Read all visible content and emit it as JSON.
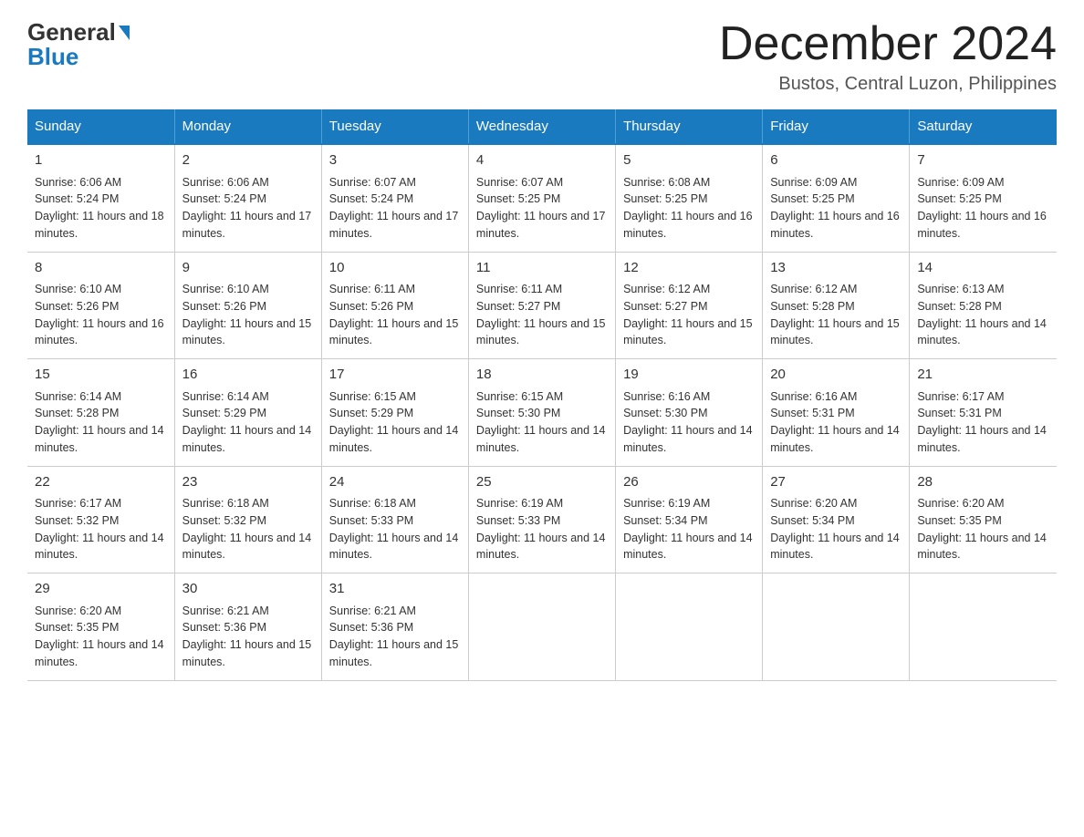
{
  "header": {
    "logo_general": "General",
    "logo_blue": "Blue",
    "month_title": "December 2024",
    "location": "Bustos, Central Luzon, Philippines"
  },
  "days_of_week": [
    "Sunday",
    "Monday",
    "Tuesday",
    "Wednesday",
    "Thursday",
    "Friday",
    "Saturday"
  ],
  "weeks": [
    [
      {
        "day": 1,
        "sunrise": "Sunrise: 6:06 AM",
        "sunset": "Sunset: 5:24 PM",
        "daylight": "Daylight: 11 hours and 18 minutes."
      },
      {
        "day": 2,
        "sunrise": "Sunrise: 6:06 AM",
        "sunset": "Sunset: 5:24 PM",
        "daylight": "Daylight: 11 hours and 17 minutes."
      },
      {
        "day": 3,
        "sunrise": "Sunrise: 6:07 AM",
        "sunset": "Sunset: 5:24 PM",
        "daylight": "Daylight: 11 hours and 17 minutes."
      },
      {
        "day": 4,
        "sunrise": "Sunrise: 6:07 AM",
        "sunset": "Sunset: 5:25 PM",
        "daylight": "Daylight: 11 hours and 17 minutes."
      },
      {
        "day": 5,
        "sunrise": "Sunrise: 6:08 AM",
        "sunset": "Sunset: 5:25 PM",
        "daylight": "Daylight: 11 hours and 16 minutes."
      },
      {
        "day": 6,
        "sunrise": "Sunrise: 6:09 AM",
        "sunset": "Sunset: 5:25 PM",
        "daylight": "Daylight: 11 hours and 16 minutes."
      },
      {
        "day": 7,
        "sunrise": "Sunrise: 6:09 AM",
        "sunset": "Sunset: 5:25 PM",
        "daylight": "Daylight: 11 hours and 16 minutes."
      }
    ],
    [
      {
        "day": 8,
        "sunrise": "Sunrise: 6:10 AM",
        "sunset": "Sunset: 5:26 PM",
        "daylight": "Daylight: 11 hours and 16 minutes."
      },
      {
        "day": 9,
        "sunrise": "Sunrise: 6:10 AM",
        "sunset": "Sunset: 5:26 PM",
        "daylight": "Daylight: 11 hours and 15 minutes."
      },
      {
        "day": 10,
        "sunrise": "Sunrise: 6:11 AM",
        "sunset": "Sunset: 5:26 PM",
        "daylight": "Daylight: 11 hours and 15 minutes."
      },
      {
        "day": 11,
        "sunrise": "Sunrise: 6:11 AM",
        "sunset": "Sunset: 5:27 PM",
        "daylight": "Daylight: 11 hours and 15 minutes."
      },
      {
        "day": 12,
        "sunrise": "Sunrise: 6:12 AM",
        "sunset": "Sunset: 5:27 PM",
        "daylight": "Daylight: 11 hours and 15 minutes."
      },
      {
        "day": 13,
        "sunrise": "Sunrise: 6:12 AM",
        "sunset": "Sunset: 5:28 PM",
        "daylight": "Daylight: 11 hours and 15 minutes."
      },
      {
        "day": 14,
        "sunrise": "Sunrise: 6:13 AM",
        "sunset": "Sunset: 5:28 PM",
        "daylight": "Daylight: 11 hours and 14 minutes."
      }
    ],
    [
      {
        "day": 15,
        "sunrise": "Sunrise: 6:14 AM",
        "sunset": "Sunset: 5:28 PM",
        "daylight": "Daylight: 11 hours and 14 minutes."
      },
      {
        "day": 16,
        "sunrise": "Sunrise: 6:14 AM",
        "sunset": "Sunset: 5:29 PM",
        "daylight": "Daylight: 11 hours and 14 minutes."
      },
      {
        "day": 17,
        "sunrise": "Sunrise: 6:15 AM",
        "sunset": "Sunset: 5:29 PM",
        "daylight": "Daylight: 11 hours and 14 minutes."
      },
      {
        "day": 18,
        "sunrise": "Sunrise: 6:15 AM",
        "sunset": "Sunset: 5:30 PM",
        "daylight": "Daylight: 11 hours and 14 minutes."
      },
      {
        "day": 19,
        "sunrise": "Sunrise: 6:16 AM",
        "sunset": "Sunset: 5:30 PM",
        "daylight": "Daylight: 11 hours and 14 minutes."
      },
      {
        "day": 20,
        "sunrise": "Sunrise: 6:16 AM",
        "sunset": "Sunset: 5:31 PM",
        "daylight": "Daylight: 11 hours and 14 minutes."
      },
      {
        "day": 21,
        "sunrise": "Sunrise: 6:17 AM",
        "sunset": "Sunset: 5:31 PM",
        "daylight": "Daylight: 11 hours and 14 minutes."
      }
    ],
    [
      {
        "day": 22,
        "sunrise": "Sunrise: 6:17 AM",
        "sunset": "Sunset: 5:32 PM",
        "daylight": "Daylight: 11 hours and 14 minutes."
      },
      {
        "day": 23,
        "sunrise": "Sunrise: 6:18 AM",
        "sunset": "Sunset: 5:32 PM",
        "daylight": "Daylight: 11 hours and 14 minutes."
      },
      {
        "day": 24,
        "sunrise": "Sunrise: 6:18 AM",
        "sunset": "Sunset: 5:33 PM",
        "daylight": "Daylight: 11 hours and 14 minutes."
      },
      {
        "day": 25,
        "sunrise": "Sunrise: 6:19 AM",
        "sunset": "Sunset: 5:33 PM",
        "daylight": "Daylight: 11 hours and 14 minutes."
      },
      {
        "day": 26,
        "sunrise": "Sunrise: 6:19 AM",
        "sunset": "Sunset: 5:34 PM",
        "daylight": "Daylight: 11 hours and 14 minutes."
      },
      {
        "day": 27,
        "sunrise": "Sunrise: 6:20 AM",
        "sunset": "Sunset: 5:34 PM",
        "daylight": "Daylight: 11 hours and 14 minutes."
      },
      {
        "day": 28,
        "sunrise": "Sunrise: 6:20 AM",
        "sunset": "Sunset: 5:35 PM",
        "daylight": "Daylight: 11 hours and 14 minutes."
      }
    ],
    [
      {
        "day": 29,
        "sunrise": "Sunrise: 6:20 AM",
        "sunset": "Sunset: 5:35 PM",
        "daylight": "Daylight: 11 hours and 14 minutes."
      },
      {
        "day": 30,
        "sunrise": "Sunrise: 6:21 AM",
        "sunset": "Sunset: 5:36 PM",
        "daylight": "Daylight: 11 hours and 15 minutes."
      },
      {
        "day": 31,
        "sunrise": "Sunrise: 6:21 AM",
        "sunset": "Sunset: 5:36 PM",
        "daylight": "Daylight: 11 hours and 15 minutes."
      },
      null,
      null,
      null,
      null
    ]
  ]
}
